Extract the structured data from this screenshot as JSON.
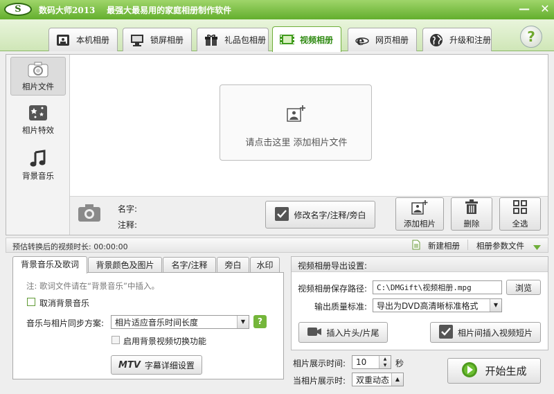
{
  "titlebar": {
    "logo_text": "S",
    "app_name": "数码大师2013",
    "slogan": "最强大最易用的家庭相册制作软件",
    "minimize_glyph": "—",
    "close_glyph": "✕"
  },
  "tabs": [
    {
      "label": "本机相册",
      "icon": "monitor-icon"
    },
    {
      "label": "锁屏相册",
      "icon": "screen-icon"
    },
    {
      "label": "礼品包相册",
      "icon": "gift-icon"
    },
    {
      "label": "视频相册",
      "icon": "film-icon",
      "active": true
    },
    {
      "label": "网页相册",
      "icon": "ie-icon"
    },
    {
      "label": "升级和注册",
      "icon": "globe-icon"
    }
  ],
  "help_glyph": "?",
  "sidebar": {
    "items": [
      {
        "label": "相片文件",
        "icon": "camera-icon",
        "active": true
      },
      {
        "label": "相片特效",
        "icon": "effects-icon"
      },
      {
        "label": "背景音乐",
        "icon": "music-note-icon"
      }
    ]
  },
  "photo_area": {
    "drop_hint": "请点击这里 添加相片文件"
  },
  "info": {
    "name_label": "名字:",
    "note_label": "注释:",
    "edit_button": "修改名字/注释/旁白",
    "add_photo": "添加相片",
    "delete": "删除",
    "select_all": "全选"
  },
  "status": {
    "duration_text": "预估转换后的视频时长: 00:00:00",
    "new_album": "新建相册",
    "album_params": "相册参数文件"
  },
  "panel_tabs": [
    {
      "label": "背景音乐及歌词",
      "active": true
    },
    {
      "label": "背景颜色及图片"
    },
    {
      "label": "名字/注释"
    },
    {
      "label": "旁白"
    },
    {
      "label": "水印"
    }
  ],
  "music_tab": {
    "note": "注: 歌词文件请在“背景音乐”中插入。",
    "cancel_music": "取消背景音乐",
    "sync_label": "音乐与相片同步方案:",
    "sync_value": "相片适应音乐时间长度",
    "enable_switch": "启用背景视频切换功能",
    "mtv_logo": "MTV",
    "subtitle_settings": "字幕详细设置"
  },
  "export": {
    "heading": "视频相册导出设置:",
    "path_label": "视频相册保存路径:",
    "path_value": "C:\\DMGift\\视频相册.mpg",
    "browse": "浏览",
    "quality_label": "输出质量标准:",
    "quality_value": "导出为DVD高清晰标准格式",
    "insert_head_tail": "插入片头/片尾",
    "insert_clip": "相片间插入视频短片"
  },
  "bottom": {
    "display_time_label": "相片展示时间:",
    "display_time_value": "10",
    "seconds_unit": "秒",
    "transition_label": "当相片展示时:",
    "transition_value": "双重动态",
    "start_button": "开始生成"
  }
}
